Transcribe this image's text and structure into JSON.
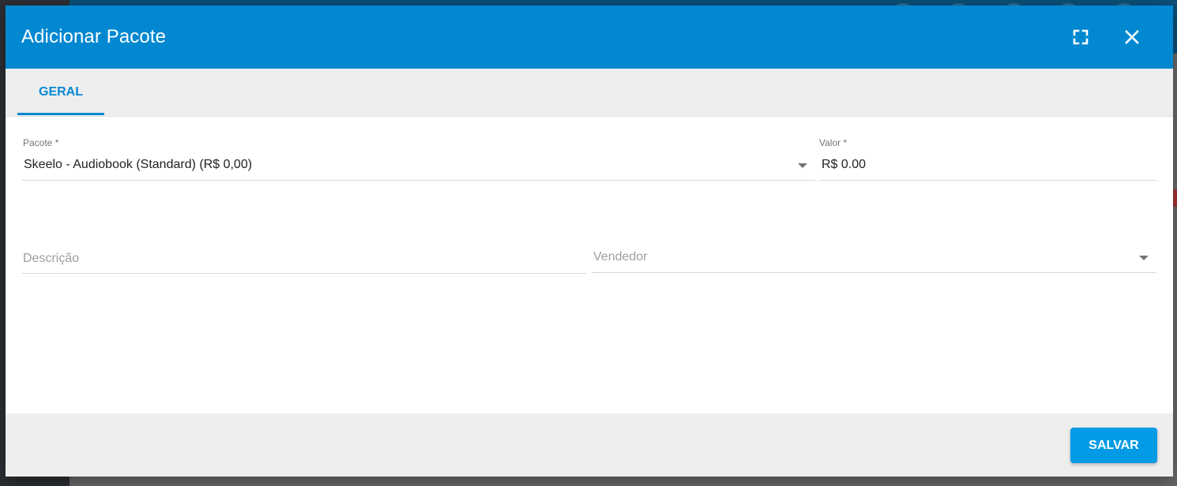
{
  "dialog": {
    "title": "Adicionar Pacote",
    "fullscreen_icon": "fullscreen-icon",
    "close_icon": "close-icon"
  },
  "tabs": [
    {
      "label": "GERAL",
      "active": true
    }
  ],
  "form": {
    "pacote": {
      "label": "Pacote *",
      "value": "Skeelo - Audiobook (Standard) (R$ 0,00)"
    },
    "valor": {
      "label": "Valor *",
      "value": "R$ 0.00"
    },
    "descricao": {
      "placeholder": "Descrição"
    },
    "vendedor": {
      "placeholder": "Vendedor"
    }
  },
  "footer": {
    "save_label": "SALVAR"
  },
  "colors": {
    "primary": "#0288d1",
    "save_button": "#039be5"
  }
}
